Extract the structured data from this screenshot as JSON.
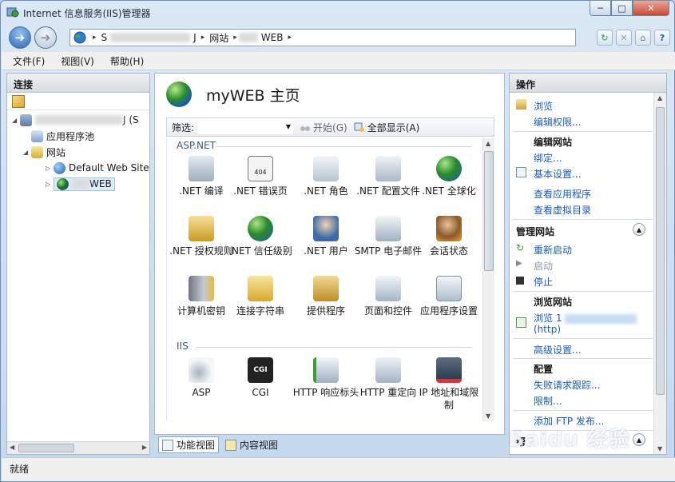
{
  "window": {
    "title": "Internet 信息服务(IIS)管理器"
  },
  "address": {
    "segments": [
      "S",
      "J",
      "网站",
      "WEB"
    ],
    "separator": "▸"
  },
  "menu": [
    "文件(F)",
    "视图(V)",
    "帮助(H)"
  ],
  "connections": {
    "header": "连接",
    "tree": {
      "server_suffix": "J (S",
      "app_pools": "应用程序池",
      "sites": "网站",
      "default_site": "Default Web Site",
      "my_site": "WEB"
    }
  },
  "center": {
    "title": "myWEB 主页",
    "filter": {
      "label": "筛选:",
      "start": "开始(G)",
      "show_all": "全部显示(A)"
    },
    "groups": [
      {
        "name": "ASP.NET"
      },
      {
        "name": "IIS"
      }
    ],
    "features": [
      ".NET 编译",
      ".NET 错误页",
      ".NET 角色",
      ".NET 配置文件",
      ".NET 全球化",
      ".NET 授权规则",
      ".NET 信任级别",
      ".NET 用户",
      "SMTP 电子邮件",
      "会话状态",
      "计算机密钥",
      "连接字符串",
      "提供程序",
      "页面和控件",
      "应用程序设置",
      "ASP",
      "CGI",
      "HTTP 响应标头",
      "HTTP 重定向",
      "IP 地址和域限制"
    ],
    "view_tabs": {
      "features": "功能视图",
      "content": "内容视图"
    }
  },
  "actions": {
    "header": "操作",
    "browse": "浏览",
    "edit_permissions": "编辑权限...",
    "edit_site": "编辑网站",
    "bindings": "绑定...",
    "basic_settings": "基本设置...",
    "view_apps": "查看应用程序",
    "view_vdirs": "查看虚拟目录",
    "manage_site": "管理网站",
    "restart": "重新启动",
    "start": "启动",
    "stop": "停止",
    "browse_site": "浏览网站",
    "browse_port": "浏览 1",
    "browse_http": "(http)",
    "advanced": "高级设置...",
    "config": "配置",
    "failed_trace": "失败请求跟踪...",
    "limits": "限制...",
    "add_ftp": "添加 FTP 发布...",
    "help_section": "帮"
  },
  "status": {
    "text": "就绪"
  },
  "watermark": "Baidu 经验"
}
